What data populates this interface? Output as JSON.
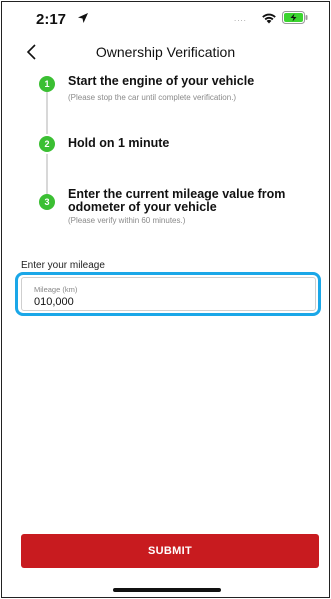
{
  "status_bar": {
    "time": "2:17",
    "signal_dots": "....",
    "icons": [
      "location-arrow-icon",
      "wifi-icon",
      "battery-charging-icon"
    ],
    "battery_color": "#3bd42f"
  },
  "nav": {
    "title": "Ownership Verification",
    "back_icon": "chevron-left-icon"
  },
  "steps": [
    {
      "number": "1",
      "title": "Start the engine of your vehicle",
      "note": "(Please stop the car until complete verification.)"
    },
    {
      "number": "2",
      "title": "Hold on 1 minute",
      "note": ""
    },
    {
      "number": "3",
      "title": "Enter the current mileage value from odometer of your vehicle",
      "note": "(Please verify within 60 minutes.)"
    }
  ],
  "mileage": {
    "section_label": "Enter your mileage",
    "field_label": "Mileage (km)",
    "value": "010,000"
  },
  "submit": {
    "label": "SUBMIT"
  },
  "colors": {
    "step_badge": "#3bbf33",
    "submit_bg": "#c81b1f",
    "highlight": "#1aa7e8"
  }
}
